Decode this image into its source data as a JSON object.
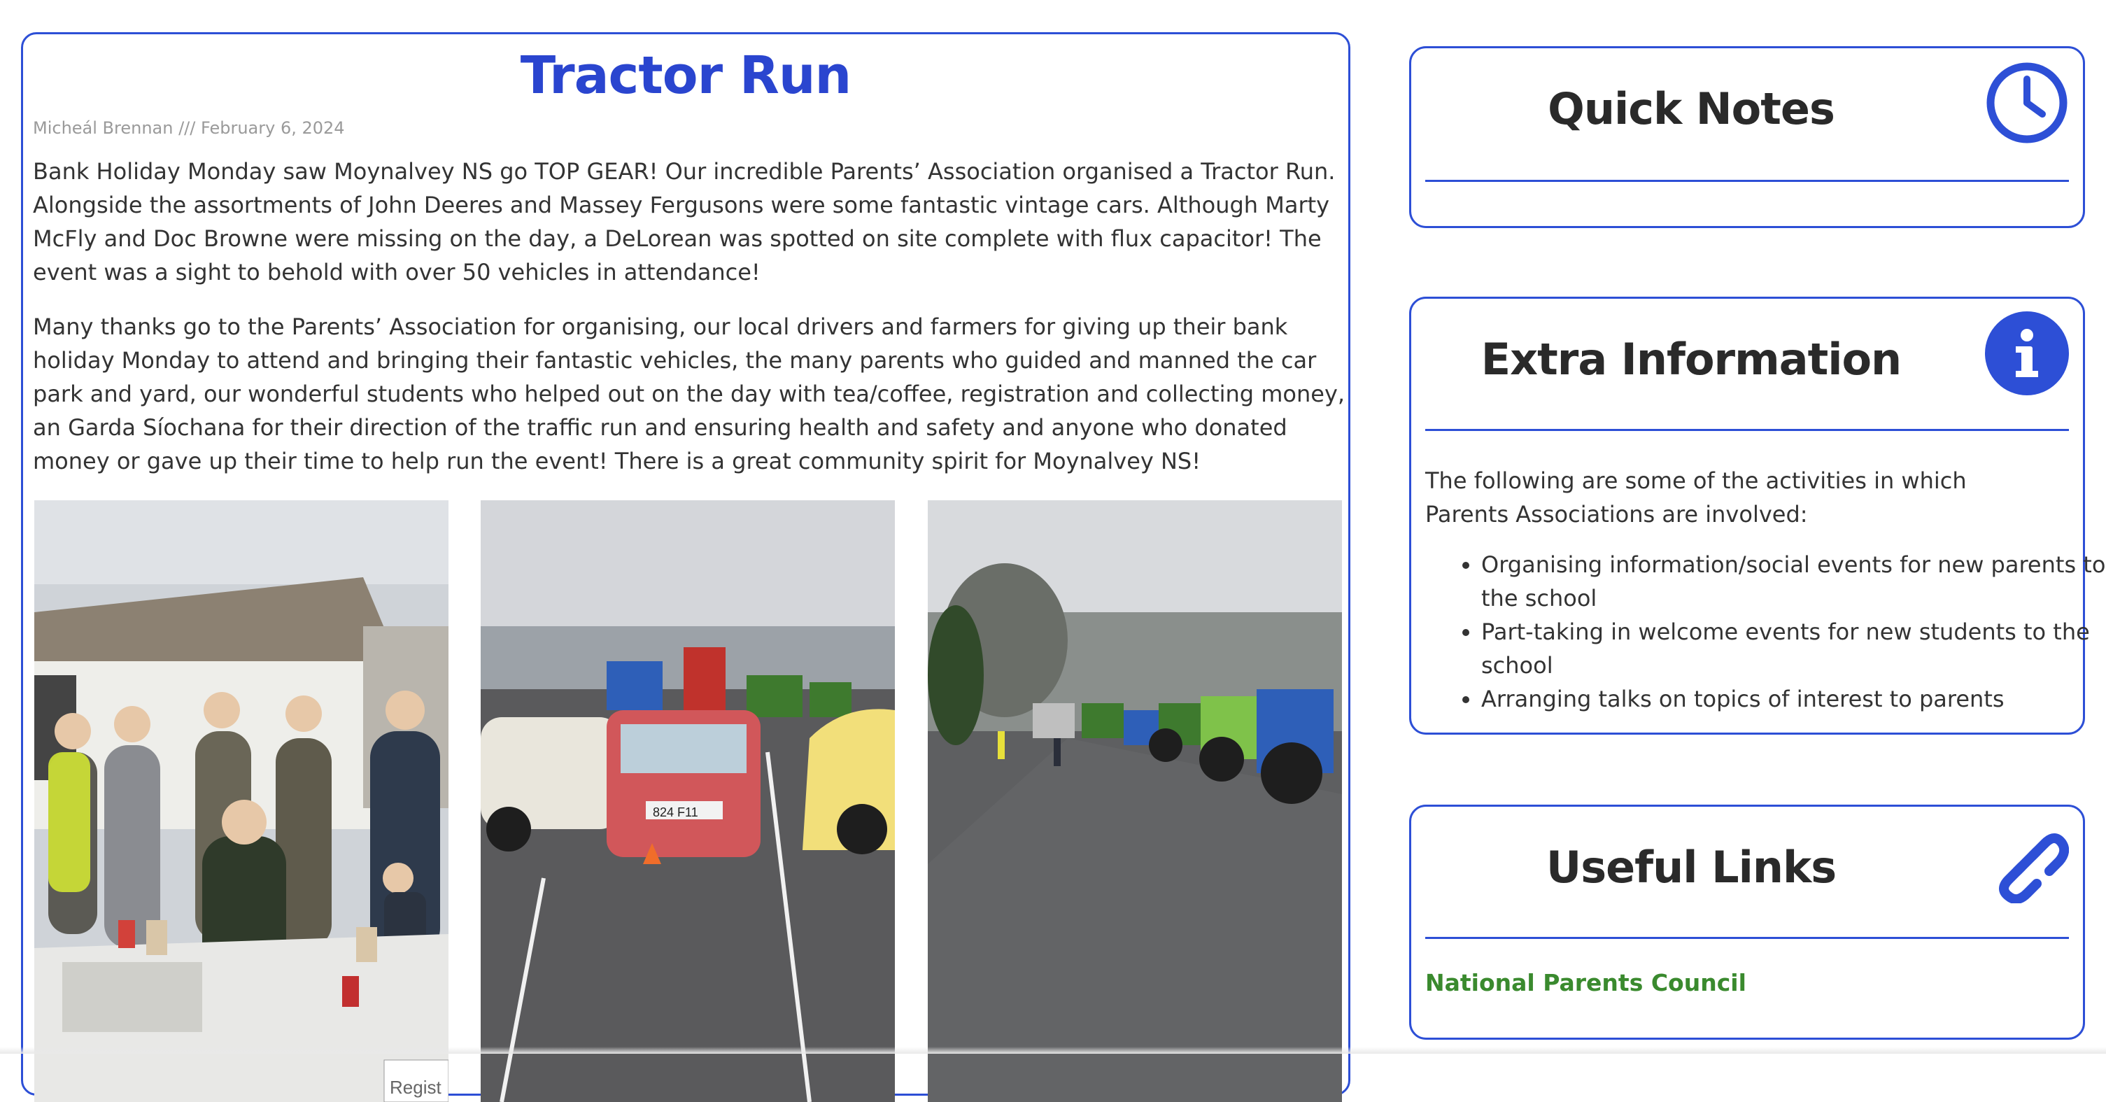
{
  "article": {
    "title": "Tractor Run",
    "byline": "Micheál Brennan /// February 6, 2024",
    "paragraphs": [
      "Bank Holiday Monday saw Moynalvey NS go TOP GEAR! Our incredible Parents’ Association organised a Tractor Run. Alongside the assortments of John Deeres and Massey Fergusons were some fantastic vintage cars. Although Marty McFly and Doc Browne were missing on the day, a DeLorean was spotted on site complete with flux capacitor! The event was a sight to behold with over 50 vehicles in attendance!",
      "Many thanks go to the Parents’ Association for organising, our local drivers and farmers for giving up their bank holiday Monday to attend and bringing their fantastic vehicles, the many parents who guided and manned the car park and yard, our wonderful students who helped out on the day with tea/coffee, registration and collecting money, an Garda Síochana for their direction of the traffic run and ensuring health and safety and anyone who donated money or gave up their time to help run the event! There is a great community spirit for Moynalvey NS!"
    ],
    "photos": [
      {
        "name": "photo-volunteers",
        "sign_text": "Regist"
      },
      {
        "name": "photo-vintage-cars",
        "plate_text": "824 F11"
      },
      {
        "name": "photo-tractors-lineup"
      }
    ]
  },
  "sidebar": {
    "quick_notes": {
      "title": "Quick Notes",
      "icon": "clock-icon"
    },
    "extra_info": {
      "title": "Extra Information",
      "icon": "info-icon",
      "intro": "The following are some of the activities in which Parents Associations are involved:",
      "items": [
        "Organising information/social events for new parents to the school",
        "Part-taking in welcome events for new students to the school",
        "Arranging talks on topics of interest to parents"
      ]
    },
    "useful_links": {
      "title": "Useful Links",
      "icon": "link-icon",
      "links": [
        "National Parents Council"
      ]
    }
  },
  "colors": {
    "accent": "#2d4fd6",
    "title_blue": "#2a45cf",
    "link_green": "#3a8a2e",
    "byline_gray": "#9a9a9a"
  }
}
